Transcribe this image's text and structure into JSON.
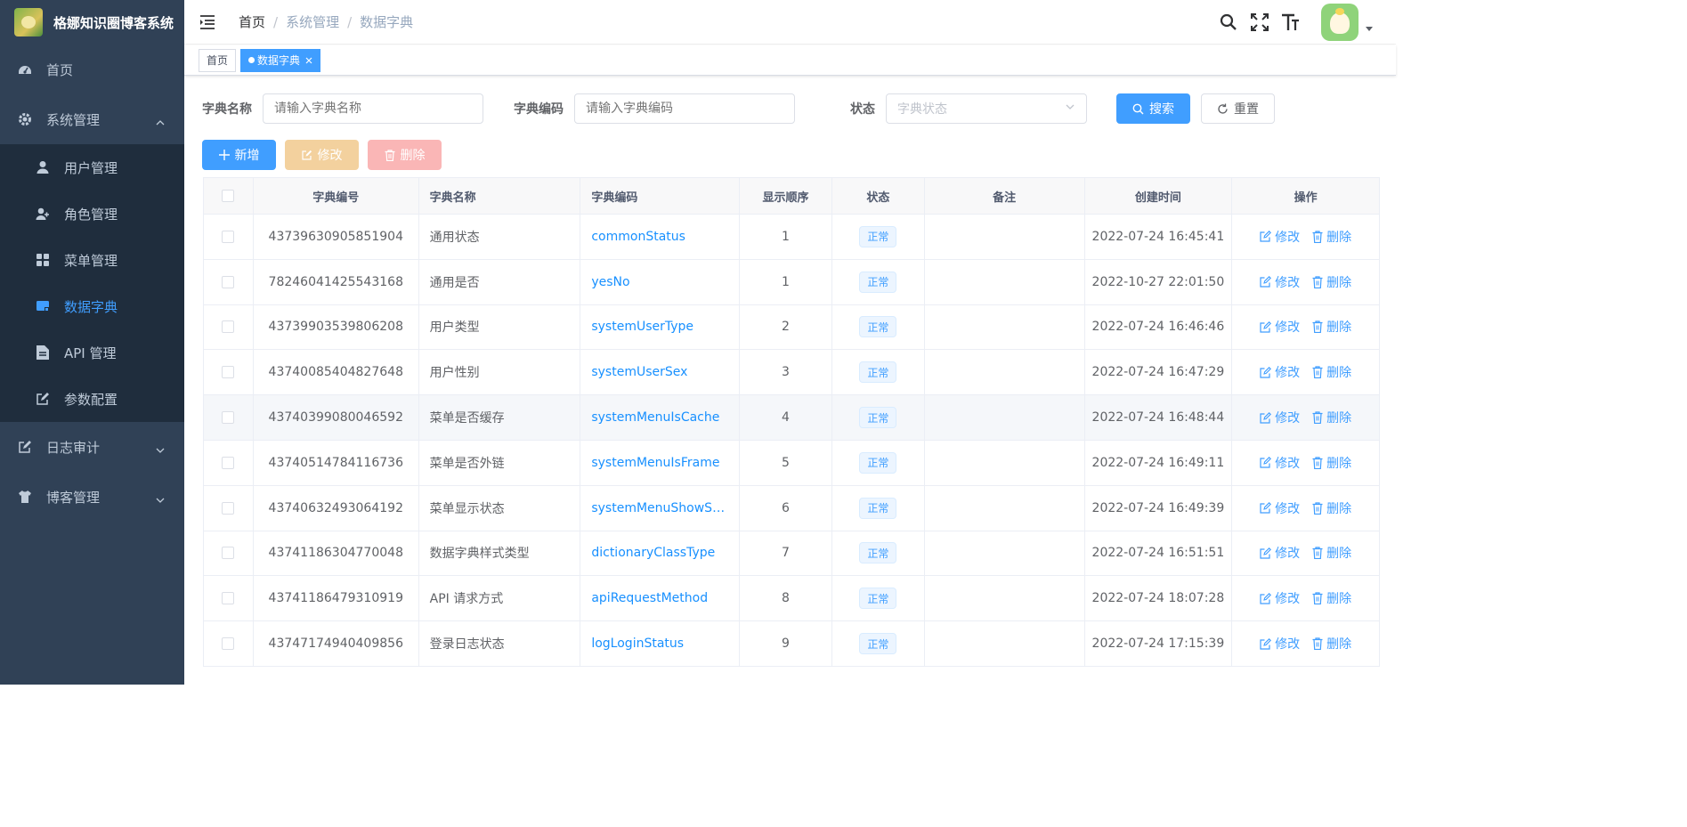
{
  "app": {
    "title": "格娜知识圈博客系统"
  },
  "sidebar": {
    "home": {
      "label": "首页",
      "icon": "dashboard-icon"
    },
    "system": {
      "label": "系统管理",
      "icon": "gear-icon",
      "items": [
        {
          "label": "用户管理",
          "icon": "user-icon"
        },
        {
          "label": "角色管理",
          "icon": "role-icon"
        },
        {
          "label": "菜单管理",
          "icon": "grid-icon"
        },
        {
          "label": "数据字典",
          "icon": "dictionary-icon",
          "active": true
        },
        {
          "label": "API 管理",
          "icon": "document-icon"
        },
        {
          "label": "参数配置",
          "icon": "edit-icon"
        }
      ]
    },
    "audit": {
      "label": "日志审计",
      "icon": "edit-icon"
    },
    "blog": {
      "label": "博客管理",
      "icon": "shirt-icon"
    }
  },
  "breadcrumb": [
    "首页",
    "系统管理",
    "数据字典"
  ],
  "tags": [
    {
      "label": "首页"
    },
    {
      "label": "数据字典",
      "active": true
    }
  ],
  "search": {
    "name_label": "字典名称",
    "name_placeholder": "请输入字典名称",
    "code_label": "字典编码",
    "code_placeholder": "请输入字典编码",
    "status_label": "状态",
    "status_placeholder": "字典状态",
    "search_btn": "搜索",
    "reset_btn": "重置"
  },
  "toolbar": {
    "add": "新增",
    "edit": "修改",
    "delete": "删除"
  },
  "table": {
    "headers": [
      "字典编号",
      "字典名称",
      "字典编码",
      "显示顺序",
      "状态",
      "备注",
      "创建时间",
      "操作"
    ],
    "rows": [
      {
        "id": "43739630905851904",
        "name": "通用状态",
        "code": "commonStatus",
        "order": "1",
        "status": "正常",
        "remark": "",
        "created": "2022-07-24 16:45:41"
      },
      {
        "id": "78246041425543168",
        "name": "通用是否",
        "code": "yesNo",
        "order": "1",
        "status": "正常",
        "remark": "",
        "created": "2022-10-27 22:01:50"
      },
      {
        "id": "43739903539806208",
        "name": "用户类型",
        "code": "systemUserType",
        "order": "2",
        "status": "正常",
        "remark": "",
        "created": "2022-07-24 16:46:46"
      },
      {
        "id": "43740085404827648",
        "name": "用户性别",
        "code": "systemUserSex",
        "order": "3",
        "status": "正常",
        "remark": "",
        "created": "2022-07-24 16:47:29"
      },
      {
        "id": "43740399080046592",
        "name": "菜单是否缓存",
        "code": "systemMenuIsCache",
        "order": "4",
        "status": "正常",
        "remark": "",
        "created": "2022-07-24 16:48:44"
      },
      {
        "id": "43740514784116736",
        "name": "菜单是否外链",
        "code": "systemMenuIsFrame",
        "order": "5",
        "status": "正常",
        "remark": "",
        "created": "2022-07-24 16:49:11"
      },
      {
        "id": "43740632493064192",
        "name": "菜单显示状态",
        "code": "systemMenuShowSt…",
        "order": "6",
        "status": "正常",
        "remark": "",
        "created": "2022-07-24 16:49:39"
      },
      {
        "id": "43741186304770048",
        "name": "数据字典样式类型",
        "code": "dictionaryClassType",
        "order": "7",
        "status": "正常",
        "remark": "",
        "created": "2022-07-24 16:51:51"
      },
      {
        "id": "43741186479310919",
        "name": "API 请求方式",
        "code": "apiRequestMethod",
        "order": "8",
        "status": "正常",
        "remark": "",
        "created": "2022-07-24 18:07:28"
      },
      {
        "id": "43747174940409856",
        "name": "登录日志状态",
        "code": "logLoginStatus",
        "order": "9",
        "status": "正常",
        "remark": "",
        "created": "2022-07-24 17:15:39"
      }
    ],
    "op_edit": "修改",
    "op_delete": "删除"
  },
  "colors": {
    "sidebar_bg": "#304156",
    "submenu_bg": "#1f2d3d",
    "primary": "#409eff",
    "warning_disabled": "#f3d19e",
    "danger_disabled": "#fab6b6"
  }
}
